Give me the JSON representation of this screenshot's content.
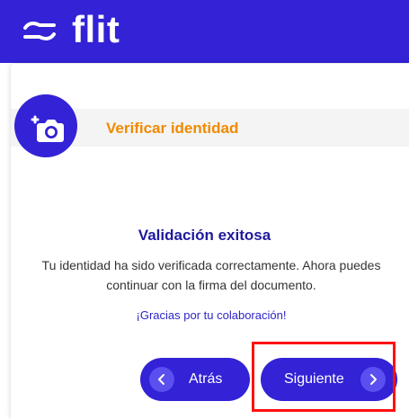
{
  "header": {
    "logo_text": "flit",
    "logo_icon": "flit-logo-icon",
    "color": "#3322d6"
  },
  "section": {
    "title": "Verificar identidad",
    "icon": "add-photo-camera-icon",
    "title_color": "#f08a00"
  },
  "result": {
    "title": "Validación exitosa",
    "message": "Tu identidad ha sido verificada correctamente. Ahora puedes continuar con la firma del documento.",
    "thanks": "¡Gracias por tu colaboración!"
  },
  "buttons": {
    "back_label": "Atrás",
    "back_icon": "chevron-left-icon",
    "next_label": "Siguiente",
    "next_icon": "chevron-right-icon"
  },
  "highlight_color": "#ff1111"
}
